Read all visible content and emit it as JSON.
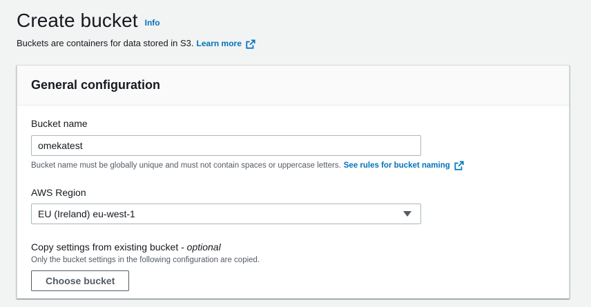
{
  "header": {
    "title": "Create bucket",
    "info_label": "Info",
    "description": "Buckets are containers for data stored in S3.",
    "learn_more": "Learn more"
  },
  "panel": {
    "title": "General configuration",
    "bucket_name": {
      "label": "Bucket name",
      "value": "omekatest",
      "constraint": "Bucket name must be globally unique and must not contain spaces or uppercase letters.",
      "rules_link": "See rules for bucket naming"
    },
    "region": {
      "label": "AWS Region",
      "selected": "EU (Ireland) eu-west-1"
    },
    "copy_settings": {
      "label": "Copy settings from existing bucket - ",
      "optional": "optional",
      "description": "Only the bucket settings in the following configuration are copied.",
      "button": "Choose bucket"
    }
  },
  "colors": {
    "link": "#0073bb",
    "background": "#f2f3f3",
    "panel_header": "#fafafa",
    "text": "#16191f",
    "secondary_text": "#545b64"
  },
  "icons": {
    "external_link": "external-link-icon",
    "dropdown": "caret-down-icon"
  }
}
